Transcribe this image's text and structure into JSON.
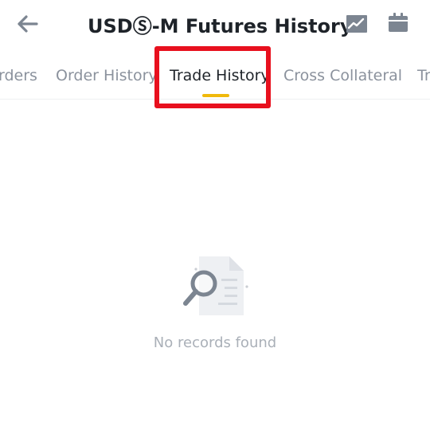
{
  "header": {
    "title": "USDⓈ-M Futures History",
    "back_icon": "arrow-left-icon",
    "chart_icon": "trend-chart-icon",
    "calendar_icon": "calendar-icon"
  },
  "tabs": [
    {
      "label": "rders"
    },
    {
      "label": "Order History"
    },
    {
      "label": "Trade History",
      "active": true
    },
    {
      "label": "Cross Collateral"
    },
    {
      "label": "Tr"
    }
  ],
  "empty_state": {
    "icon": "document-search-icon",
    "message": "No records found"
  },
  "colors": {
    "accent": "#f0b90b",
    "highlight": "#e8101e",
    "text_primary": "#1e2329",
    "text_secondary": "#8b929d",
    "icon_gray": "#7c8591"
  }
}
